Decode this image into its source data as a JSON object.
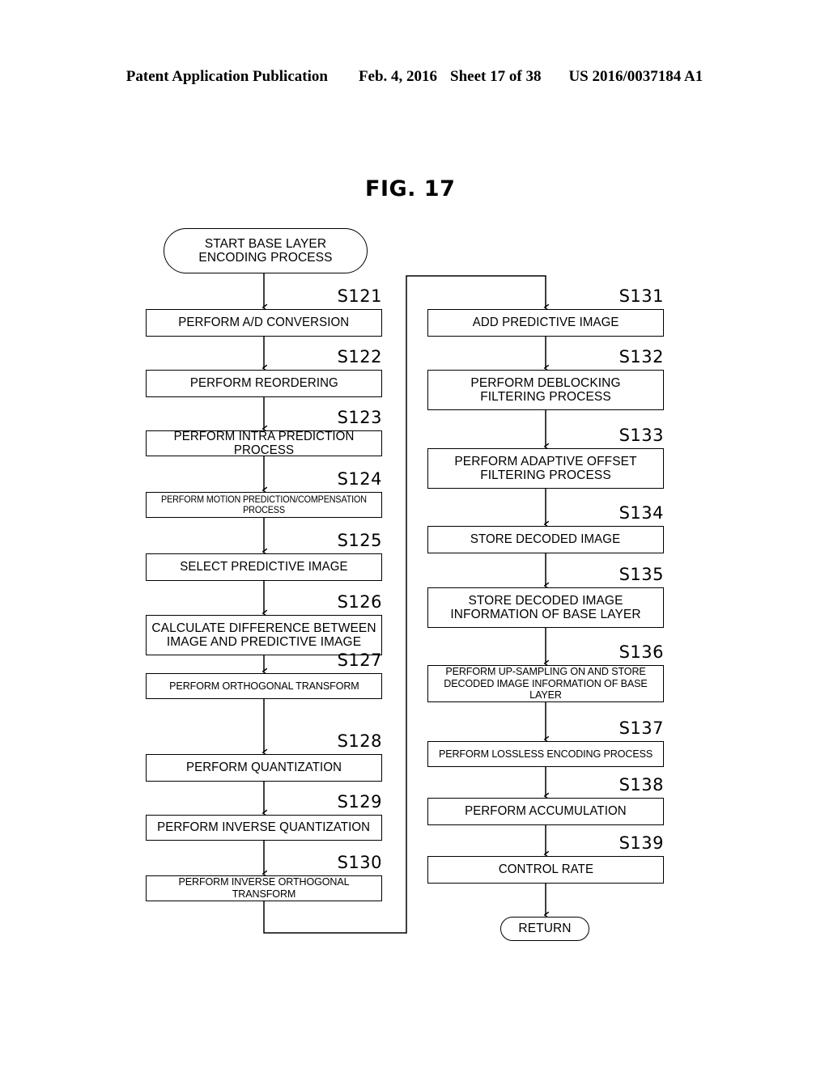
{
  "header": {
    "publication": "Patent Application Publication",
    "date": "Feb. 4, 2016",
    "sheet": "Sheet 17 of 38",
    "patent_number": "US 2016/0037184 A1"
  },
  "figure": {
    "title": "FIG. 17"
  },
  "flowchart": {
    "type": "flowchart",
    "start_node": {
      "id": "start",
      "label": "START BASE LAYER\nENCODING PROCESS"
    },
    "end_node": {
      "id": "return",
      "label": "RETURN"
    },
    "left_column": [
      {
        "step": "S121",
        "label": "PERFORM A/D CONVERSION"
      },
      {
        "step": "S122",
        "label": "PERFORM REORDERING"
      },
      {
        "step": "S123",
        "label": "PERFORM INTRA PREDICTION PROCESS"
      },
      {
        "step": "S124",
        "label": "PERFORM MOTION PREDICTION/COMPENSATION PROCESS"
      },
      {
        "step": "S125",
        "label": "SELECT PREDICTIVE IMAGE"
      },
      {
        "step": "S126",
        "label": "CALCULATE DIFFERENCE BETWEEN\nIMAGE AND PREDICTIVE IMAGE"
      },
      {
        "step": "S127",
        "label": "PERFORM ORTHOGONAL TRANSFORM"
      },
      {
        "step": "S128",
        "label": "PERFORM QUANTIZATION"
      },
      {
        "step": "S129",
        "label": "PERFORM INVERSE QUANTIZATION"
      },
      {
        "step": "S130",
        "label": "PERFORM INVERSE ORTHOGONAL TRANSFORM"
      }
    ],
    "right_column": [
      {
        "step": "S131",
        "label": "ADD PREDICTIVE IMAGE"
      },
      {
        "step": "S132",
        "label": "PERFORM DEBLOCKING\nFILTERING PROCESS"
      },
      {
        "step": "S133",
        "label": "PERFORM ADAPTIVE OFFSET\nFILTERING PROCESS"
      },
      {
        "step": "S134",
        "label": "STORE DECODED IMAGE"
      },
      {
        "step": "S135",
        "label": "STORE DECODED IMAGE\nINFORMATION OF BASE LAYER"
      },
      {
        "step": "S136",
        "label": "PERFORM UP-SAMPLING ON AND STORE\nDECODED IMAGE INFORMATION OF BASE LAYER"
      },
      {
        "step": "S137",
        "label": "PERFORM LOSSLESS ENCODING PROCESS"
      },
      {
        "step": "S138",
        "label": "PERFORM ACCUMULATION"
      },
      {
        "step": "S139",
        "label": "CONTROL RATE"
      }
    ]
  },
  "colors": {
    "ink": "#000000",
    "paper": "#ffffff"
  }
}
